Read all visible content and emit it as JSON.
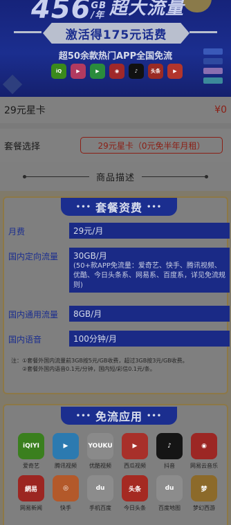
{
  "banner": {
    "headline_number": "456",
    "headline_unit_top": "GB",
    "headline_unit_bottom": "/年",
    "headline_suffix": "超大流量",
    "ribbon": "激活得175元话费",
    "subtitle": "超50余款热门APP全国免流",
    "strip_apps": [
      {
        "name": "iqiyi",
        "text": "iQ",
        "color": "#3a8a1c"
      },
      {
        "name": "video-app",
        "text": "▶",
        "color": "#b23a60"
      },
      {
        "name": "tencent-video",
        "text": "▶",
        "color": "#2a8c3c"
      },
      {
        "name": "netease-music",
        "text": "◉",
        "color": "#a0282a"
      },
      {
        "name": "douyin",
        "text": "♪",
        "color": "#111111"
      },
      {
        "name": "toutiao",
        "text": "头条",
        "color": "#9a2a24"
      },
      {
        "name": "xigua",
        "text": "▶",
        "color": "#b2352c"
      }
    ]
  },
  "order": {
    "plan_name": "29元星卡",
    "price": "¥0",
    "package_label": "套餐选择",
    "package_option": "29元星卡（0元免半年月租）"
  },
  "description": {
    "section_title": "商品描述",
    "panel_title": "套餐资费",
    "specs": [
      {
        "key": "月费",
        "value": "29元/月",
        "detail": ""
      },
      {
        "key": "国内定向流量",
        "value": "30GB/月",
        "detail": "(50+款APP免流量：爱奇艺、快手、腾讯视频、优酷、今日头条系、网易系、百度系，详见免流规则)"
      },
      {
        "key": "国内通用流量",
        "value": "8GB/月",
        "detail": ""
      },
      {
        "key": "国内语音",
        "value": "100分钟/月",
        "detail": ""
      }
    ],
    "notes": [
      "注：①套餐外国内流量前3GB按5元/GB收费，超过3GB按3元/GB收费。",
      "　　②套餐外国内语音0.1元/分钟，国内短/彩信0.1元/条。"
    ]
  },
  "free_apps": {
    "panel_title": "免流应用",
    "apps": [
      {
        "label": "爱奇艺",
        "icon": "iqiyi-icon",
        "glyph": "iQIYI",
        "color": "#3a7f1e"
      },
      {
        "label": "腾讯视频",
        "icon": "tencent-video-icon",
        "glyph": "▶",
        "color": "#2c7ab0"
      },
      {
        "label": "优酷视频",
        "icon": "youku-icon",
        "glyph": "YOUKU",
        "color": "#8a8a8a"
      },
      {
        "label": "西瓜视频",
        "icon": "xigua-icon",
        "glyph": "▶",
        "color": "#a8302a"
      },
      {
        "label": "抖音",
        "icon": "douyin-icon",
        "glyph": "♪",
        "color": "#151515"
      },
      {
        "label": "网易云音乐",
        "icon": "netease-music-icon",
        "glyph": "◉",
        "color": "#9c2724"
      },
      {
        "label": "网易新闻",
        "icon": "netease-news-icon",
        "glyph": "網易",
        "color": "#9c2622"
      },
      {
        "label": "快手",
        "icon": "kuaishou-icon",
        "glyph": "◎",
        "color": "#b3592a"
      },
      {
        "label": "手机百度",
        "icon": "baidu-icon",
        "glyph": "du",
        "color": "#8c8c8c"
      },
      {
        "label": "今日头条",
        "icon": "toutiao-icon",
        "glyph": "头条",
        "color": "#a52a22"
      },
      {
        "label": "百度地图",
        "icon": "baidu-map-icon",
        "glyph": "du",
        "color": "#8c8c8c"
      },
      {
        "label": "梦幻西游",
        "icon": "menghuan-icon",
        "glyph": "梦",
        "color": "#8c6a2a"
      }
    ]
  }
}
